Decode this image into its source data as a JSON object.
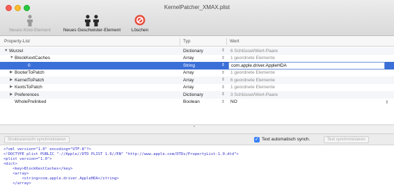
{
  "window": {
    "title": "KernelPatcher_XMAX.plist"
  },
  "toolbar": {
    "new_child_label": "Neues Kind-Element",
    "new_sibling_label": "Neues Geschwister-Element",
    "delete_label": "Löschen"
  },
  "columns": {
    "key": "Property-List",
    "type": "Typ",
    "value": "Wert"
  },
  "rows": [
    {
      "key": "Wurzel",
      "type": "Dictionary",
      "value": "6 Schlüssel/Wert-Paare"
    },
    {
      "key": "BlockKextCaches",
      "type": "Array",
      "value": "1 geordnete Elemente"
    },
    {
      "key": "0",
      "type": "String",
      "value": "com.apple.driver.AppleHDA"
    },
    {
      "key": "BooterToPatch",
      "type": "Array",
      "value": "1 geordnete Elemente"
    },
    {
      "key": "KernelToPatch",
      "type": "Array",
      "value": "6 geordnete Elemente"
    },
    {
      "key": "KextsToPatch",
      "type": "Array",
      "value": "1 geordnete Elemente"
    },
    {
      "key": "Preferences",
      "type": "Dictionary",
      "value": "3 Schlüssel/Wert-Paare"
    },
    {
      "key": "WholePrelinked",
      "type": "Boolean",
      "value": "NO"
    }
  ],
  "bottom": {
    "sync_structure_label": "Strukturansicht synchronisieren",
    "auto_sync_label": "Text automatisch synch.",
    "sync_text_label": "Text synchronisieren"
  },
  "xml_lines": [
    "<?xml version=\"1.0\" encoding=\"UTF-8\"?>",
    "<!DOCTYPE plist PUBLIC \"-//Apple//DTD PLIST 1.0//EN\" \"http://www.apple.com/DTDs/PropertyList-1.0.dtd\">",
    "<plist version=\"1.0\">",
    "<dict>",
    "    <key>BlockKextCaches</key>",
    "    <array>",
    "        <string>com.apple.driver.AppleHDA</string>",
    "    </array>"
  ]
}
